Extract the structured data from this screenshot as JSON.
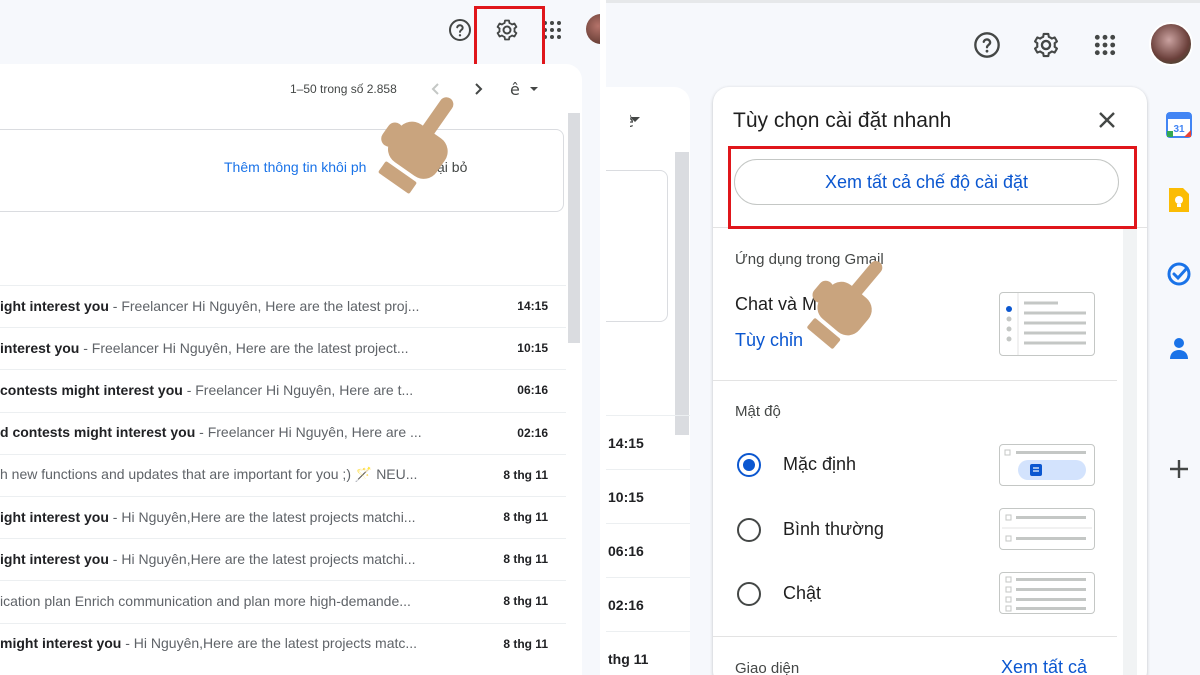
{
  "left": {
    "pager": "1–50 trong số 2.858",
    "banner": {
      "text": "Thêm thông tin khôi ph",
      "dismiss": "ại bỏ"
    },
    "emails": [
      {
        "subject": "ight interest you",
        "snippet": " - Freelancer Hi Nguyên, Here are the latest proj...",
        "time": "14:15"
      },
      {
        "subject": " interest you",
        "snippet": " - Freelancer Hi Nguyên, Here are the latest project...",
        "time": "10:15"
      },
      {
        "subject": "contests might interest you",
        "snippet": " - Freelancer Hi Nguyên, Here are t...",
        "time": "06:16"
      },
      {
        "subject": "d contests might interest you",
        "snippet": " - Freelancer Hi Nguyên, Here are ...",
        "time": "02:16"
      },
      {
        "subject": "",
        "snippet": "h new functions and updates that are important for you ;) 🪄 NEU...",
        "time": "8 thg 11"
      },
      {
        "subject": "ight interest you",
        "snippet": " - Hi Nguyên,Here are the latest projects matchi...",
        "time": "8 thg 11"
      },
      {
        "subject": "ight interest you",
        "snippet": " - Hi Nguyên,Here are the latest projects matchi...",
        "time": "8 thg 11"
      },
      {
        "subject": "",
        "snippet": "ication plan Enrich communication and plan more high-demande...",
        "time": "8 thg 11"
      },
      {
        "subject": "might interest you",
        "snippet": " - Hi Nguyên,Here are the latest projects matc...",
        "time": "8 thg 11"
      }
    ]
  },
  "right": {
    "times": [
      "14:15",
      "10:15",
      "06:16",
      "02:16",
      "thg 11"
    ],
    "quick_settings": {
      "title": "Tùy chọn cài đặt nhanh",
      "see_all_button": "Xem tất cả chế độ cài đặt",
      "apps_section": "Ứng dụng trong Gmail",
      "chat_label": "Chat và M",
      "customize_link": "Tùy chỉn",
      "density_section": "Mật độ",
      "density_options": [
        {
          "label": "Mặc định",
          "selected": true
        },
        {
          "label": "Bình thường",
          "selected": false
        },
        {
          "label": "Chật",
          "selected": false
        }
      ],
      "theme_section": "Giao diện",
      "theme_see_all": "Xem tất cả"
    },
    "side_apps": {
      "calendar_date": "31"
    }
  },
  "colors": {
    "accent": "#0b57d0",
    "highlight_box": "#e0161b",
    "hand": "#c9a47e"
  }
}
